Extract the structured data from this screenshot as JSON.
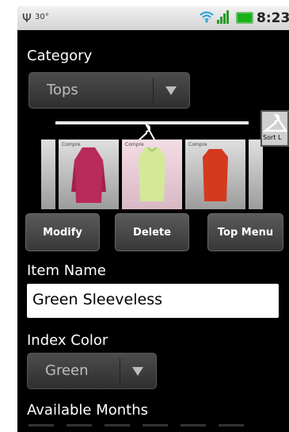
{
  "status_bar": {
    "temperature": "30°",
    "time": "8:23",
    "icons": [
      "usb-icon",
      "wifi-icon",
      "signal-icon",
      "battery-icon"
    ]
  },
  "category": {
    "label": "Category",
    "selected": "Tops"
  },
  "gallery": {
    "items": [
      {
        "label": "Compre",
        "color": "#b82a5a"
      },
      {
        "label": "Compre",
        "color": "#b8d67a"
      },
      {
        "label": "Compre",
        "color": "#d43a1e"
      }
    ],
    "sort_label": "Sort L"
  },
  "buttons": {
    "modify": "Modify",
    "delete": "Delete",
    "top_menu": "Top Menu"
  },
  "item_name": {
    "label": "Item Name",
    "value": "Green Sleeveless"
  },
  "index_color": {
    "label": "Index Color",
    "selected": "Green"
  },
  "available_months": {
    "label": "Available Months"
  }
}
